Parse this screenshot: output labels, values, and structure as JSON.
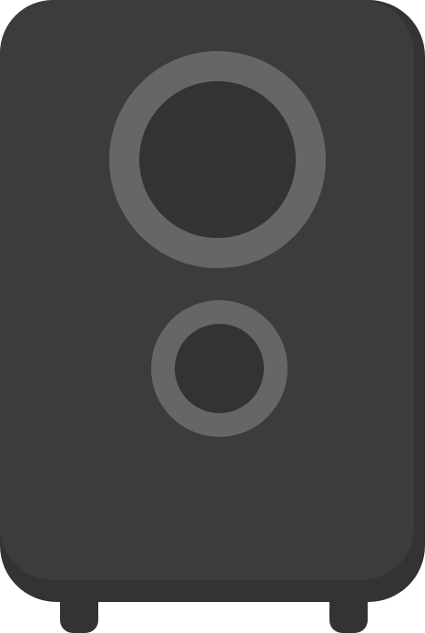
{
  "illustration": {
    "subject": "speaker-icon",
    "colors": {
      "cabinet_shadow": "#333333",
      "cabinet_face": "#3c3c3c",
      "feet": "#333333",
      "driver_ring": "#666666",
      "driver_cone": "#333333",
      "background": "#ffffff"
    },
    "drivers": [
      {
        "name": "woofer"
      },
      {
        "name": "tweeter"
      }
    ]
  }
}
